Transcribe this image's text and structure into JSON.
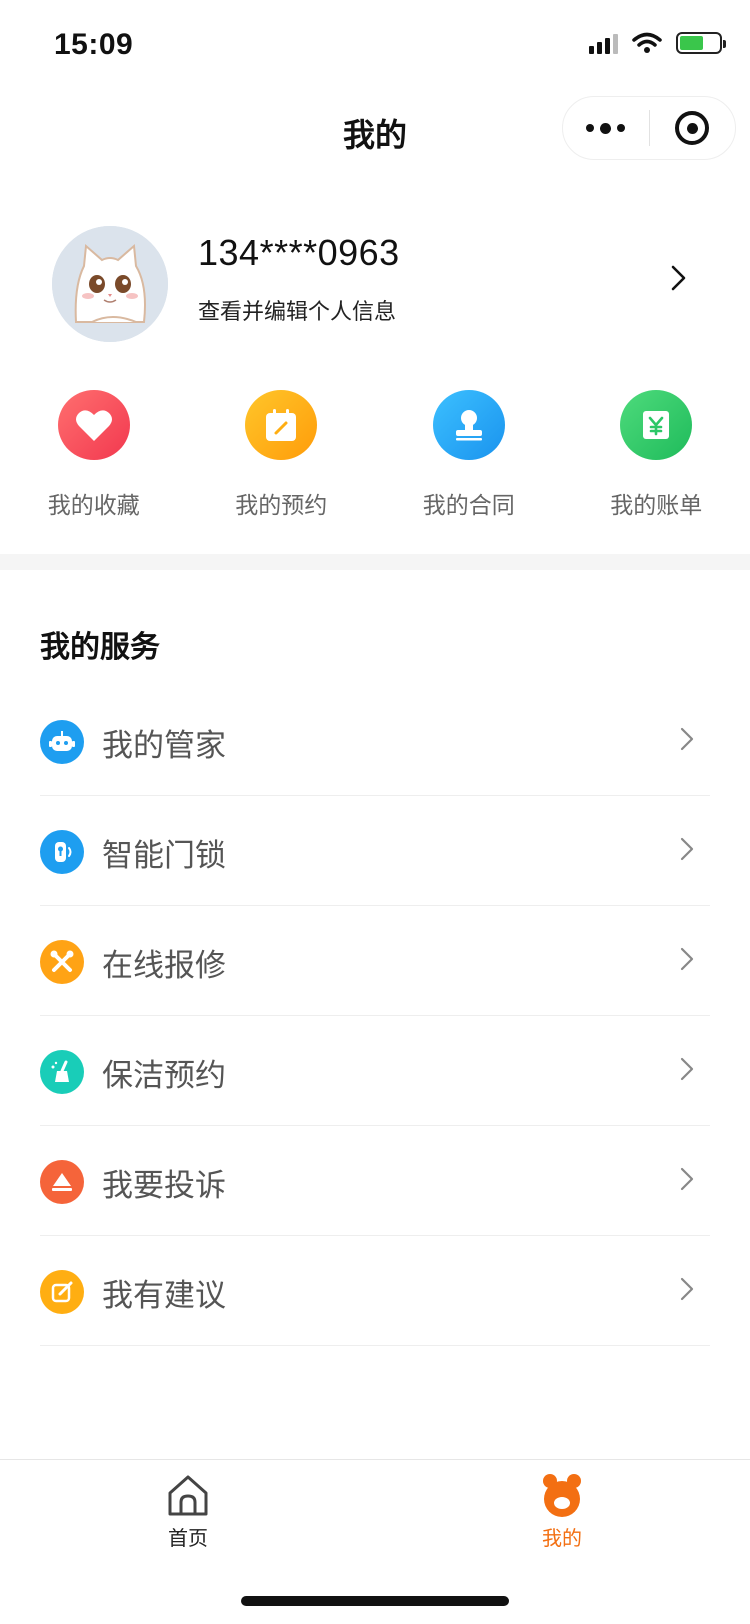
{
  "status_bar": {
    "time": "15:09",
    "battery_level": 0.6
  },
  "nav": {
    "title": "我的",
    "more_icon": "more-dots-icon",
    "close_icon": "target-circle-icon"
  },
  "profile": {
    "phone": "134****0963",
    "subtitle": "查看并编辑个人信息",
    "avatar_icon": "cat-avatar"
  },
  "quick_links": [
    {
      "label": "我的收藏",
      "icon": "heart-icon",
      "color": "#f34a57"
    },
    {
      "label": "我的预约",
      "icon": "calendar-edit-icon",
      "color": "#ffae12"
    },
    {
      "label": "我的合同",
      "icon": "stamp-icon",
      "color": "#21a7f2"
    },
    {
      "label": "我的账单",
      "icon": "bill-yen-icon",
      "color": "#2bc767"
    }
  ],
  "services": {
    "title": "我的服务",
    "items": [
      {
        "label": "我的管家",
        "icon": "robot-icon",
        "color": "#1e9ef0"
      },
      {
        "label": "智能门锁",
        "icon": "smart-lock-icon",
        "color": "#1e9ef0"
      },
      {
        "label": "在线报修",
        "icon": "repair-tools-icon",
        "color": "#ffa315"
      },
      {
        "label": "保洁预约",
        "icon": "cleaning-broom-icon",
        "color": "#19cdb8"
      },
      {
        "label": "我要投诉",
        "icon": "complaint-megaphone-icon",
        "color": "#f5643a"
      },
      {
        "label": "我有建议",
        "icon": "suggestion-edit-icon",
        "color": "#ffae12"
      }
    ]
  },
  "tabbar": {
    "items": [
      {
        "label": "首页",
        "icon": "home-icon"
      },
      {
        "label": "我的",
        "icon": "mine-bear-icon",
        "active": true
      }
    ],
    "active_color": "#f36f12"
  }
}
